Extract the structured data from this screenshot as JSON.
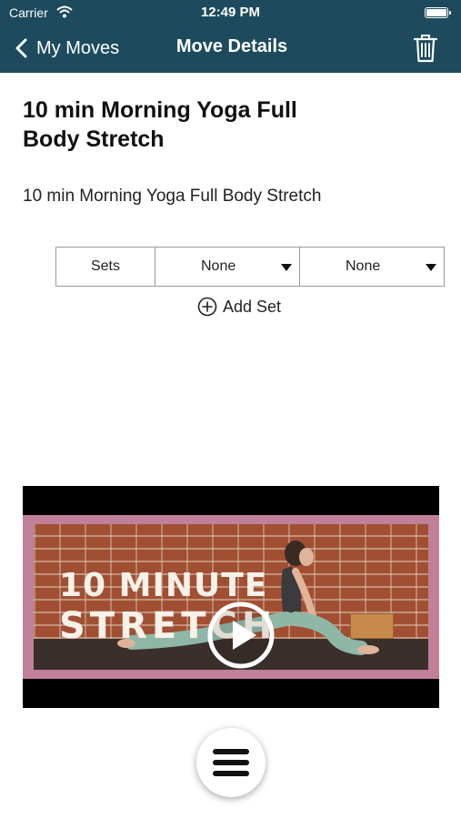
{
  "status_bar": {
    "carrier": "Carrier",
    "time": "12:49 PM",
    "battery_level": 1.0
  },
  "nav": {
    "back_label": "My Moves",
    "title": "Move Details",
    "back_icon": "chevron-left-icon",
    "delete_icon": "trash-icon"
  },
  "move": {
    "title": "10 min Morning Yoga Full Body Stretch",
    "description": "10 min Morning Yoga Full Body Stretch"
  },
  "set_table": {
    "sets_label": "Sets",
    "option_1": "None",
    "option_2": "None"
  },
  "add_set": {
    "label": "Add Set",
    "icon": "plus-circle-icon"
  },
  "video": {
    "title_line_1": "10 MINUTE",
    "title_line_2": "STRETCH",
    "play_icon": "play-icon"
  },
  "menu": {
    "icon": "hamburger-menu-icon"
  },
  "colors": {
    "nav_background": "#1d4b5d",
    "nav_text": "#ffffff",
    "video_frame": "#c0809a"
  }
}
